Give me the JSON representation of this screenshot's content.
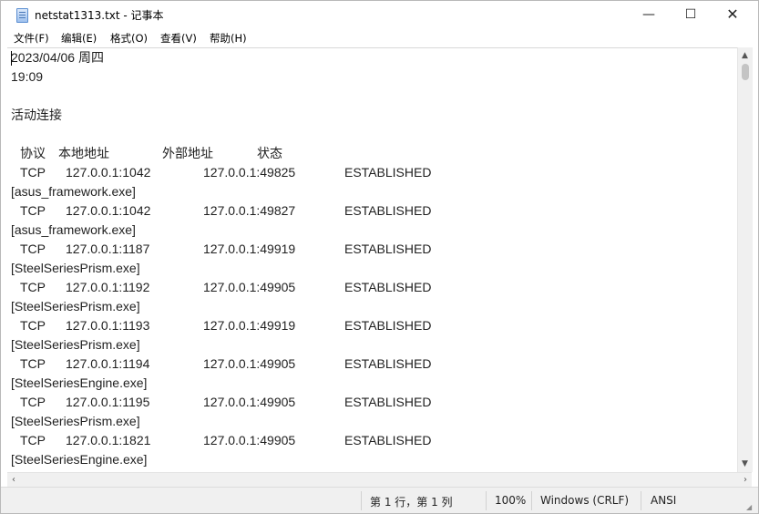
{
  "window": {
    "title": "netstat1313.txt - 记事本",
    "controls": {
      "minimize_icon": "—",
      "maximize_icon": "☐",
      "close_icon": "✕"
    }
  },
  "menu": {
    "items": [
      {
        "label": "文件(F)"
      },
      {
        "label": "编辑(E)"
      },
      {
        "label": "格式(O)"
      },
      {
        "label": "查看(V)"
      },
      {
        "label": "帮助(H)"
      }
    ]
  },
  "document": {
    "date": "2023/04/06 周四",
    "time": "19:09",
    "section_title": "活动连接",
    "headers": {
      "protocol": "协议",
      "local": "本地地址",
      "foreign": "外部地址",
      "state": "状态"
    },
    "connections": [
      {
        "protocol": "TCP",
        "local": "127.0.0.1:1042",
        "foreign": "127.0.0.1:49825",
        "state": "ESTABLISHED",
        "process": "[asus_framework.exe]"
      },
      {
        "protocol": "TCP",
        "local": "127.0.0.1:1042",
        "foreign": "127.0.0.1:49827",
        "state": "ESTABLISHED",
        "process": "[asus_framework.exe]"
      },
      {
        "protocol": "TCP",
        "local": "127.0.0.1:1187",
        "foreign": "127.0.0.1:49919",
        "state": "ESTABLISHED",
        "process": "[SteelSeriesPrism.exe]"
      },
      {
        "protocol": "TCP",
        "local": "127.0.0.1:1192",
        "foreign": "127.0.0.1:49905",
        "state": "ESTABLISHED",
        "process": "[SteelSeriesPrism.exe]"
      },
      {
        "protocol": "TCP",
        "local": "127.0.0.1:1193",
        "foreign": "127.0.0.1:49919",
        "state": "ESTABLISHED",
        "process": "[SteelSeriesPrism.exe]"
      },
      {
        "protocol": "TCP",
        "local": "127.0.0.1:1194",
        "foreign": "127.0.0.1:49905",
        "state": "ESTABLISHED",
        "process": "[SteelSeriesEngine.exe]"
      },
      {
        "protocol": "TCP",
        "local": "127.0.0.1:1195",
        "foreign": "127.0.0.1:49905",
        "state": "ESTABLISHED",
        "process": "[SteelSeriesPrism.exe]"
      },
      {
        "protocol": "TCP",
        "local": "127.0.0.1:1821",
        "foreign": "127.0.0.1:49905",
        "state": "ESTABLISHED",
        "process": "[SteelSeriesEngine.exe]"
      }
    ]
  },
  "statusbar": {
    "position": "第 1 行，第 1 列",
    "zoom": "100%",
    "line_ending": "Windows (CRLF)",
    "encoding": "ANSI"
  }
}
